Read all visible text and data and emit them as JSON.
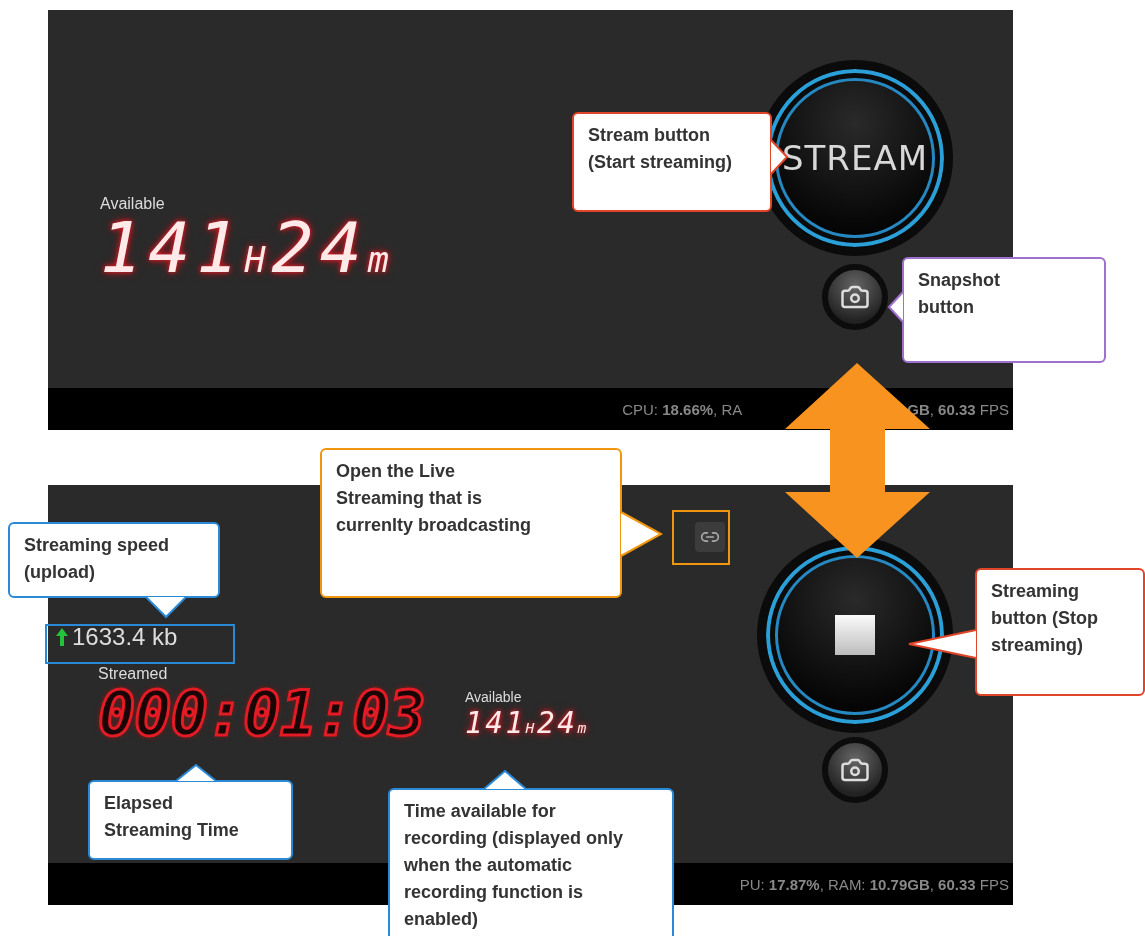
{
  "top_screen": {
    "available_label": "Available",
    "available_display": [
      {
        "text": "141",
        "kind": "digits"
      },
      {
        "text": "H",
        "kind": "unit"
      },
      {
        "text": "24",
        "kind": "digits"
      },
      {
        "text": "m",
        "kind": "unit"
      }
    ],
    "stream_button": "STREAM",
    "status_left": "CPU: **18.66%**, RA",
    "status_right": "**GB**, **60.33** FPS"
  },
  "bottom_screen": {
    "upload_speed": "1633.4 kb",
    "streamed_label": "Streamed",
    "elapsed": "000:01:03",
    "available_label": "Available",
    "available_display": [
      {
        "text": "141",
        "kind": "digits"
      },
      {
        "text": "H",
        "kind": "unit"
      },
      {
        "text": "24",
        "kind": "digits"
      },
      {
        "text": "m",
        "kind": "unit"
      }
    ],
    "status": "PU: **17.87%**, RAM: **10.79GB**, **60.33** FPS"
  },
  "callouts": [
    {
      "text": "Stream button\n(Start streaming)",
      "color": "#e0452a"
    },
    {
      "text": "Snapshot\nbutton",
      "color": "#a070d0"
    },
    {
      "text": "Open the Live\nStreaming that is\ncurrenlty broadcasting",
      "color": "#f0950e"
    },
    {
      "text": "Streaming speed\n(upload)",
      "color": "#2a8ad8"
    },
    {
      "text": "Streaming\nbutton (Stop\nstreaming)",
      "color": "#e0452a"
    },
    {
      "text": "Elapsed\nStreaming Time",
      "color": "#2a8ad8"
    },
    {
      "text": "Time available for\nrecording (displayed only\nwhen the automatic\nrecording function is\nenabled)",
      "color": "#2a8ad8"
    }
  ],
  "highlights": [
    {
      "color": "#2a8ad8"
    },
    {
      "color": "#f0950e"
    }
  ]
}
